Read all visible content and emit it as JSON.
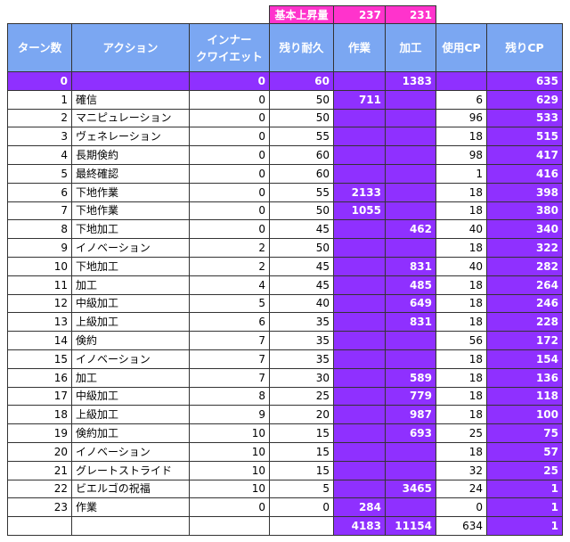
{
  "top": {
    "label": "基本上昇量",
    "craft": "237",
    "quality": "231"
  },
  "headers": [
    "ターン数",
    "アクション",
    "インナー\nクワイエット",
    "残り耐久",
    "作業",
    "加工",
    "使用CP",
    "残りCP"
  ],
  "rows": [
    {
      "turn": "0",
      "action": "",
      "iq": "0",
      "dur": "60",
      "prog": "",
      "qual": "1383",
      "cp_used": "",
      "cp_left": "635"
    },
    {
      "turn": "1",
      "action": "確信",
      "iq": "0",
      "dur": "50",
      "prog": "711",
      "qual": "",
      "cp_used": "6",
      "cp_left": "629"
    },
    {
      "turn": "2",
      "action": "マニピュレーション",
      "iq": "0",
      "dur": "50",
      "prog": "",
      "qual": "",
      "cp_used": "96",
      "cp_left": "533"
    },
    {
      "turn": "3",
      "action": "ヴェネレーション",
      "iq": "0",
      "dur": "55",
      "prog": "",
      "qual": "",
      "cp_used": "18",
      "cp_left": "515"
    },
    {
      "turn": "4",
      "action": "長期倹約",
      "iq": "0",
      "dur": "60",
      "prog": "",
      "qual": "",
      "cp_used": "98",
      "cp_left": "417"
    },
    {
      "turn": "5",
      "action": "最終確認",
      "iq": "0",
      "dur": "60",
      "prog": "",
      "qual": "",
      "cp_used": "1",
      "cp_left": "416"
    },
    {
      "turn": "6",
      "action": "下地作業",
      "iq": "0",
      "dur": "55",
      "prog": "2133",
      "qual": "",
      "cp_used": "18",
      "cp_left": "398"
    },
    {
      "turn": "7",
      "action": "下地作業",
      "iq": "0",
      "dur": "50",
      "prog": "1055",
      "qual": "",
      "cp_used": "18",
      "cp_left": "380"
    },
    {
      "turn": "8",
      "action": "下地加工",
      "iq": "0",
      "dur": "45",
      "prog": "",
      "qual": "462",
      "cp_used": "40",
      "cp_left": "340"
    },
    {
      "turn": "9",
      "action": "イノベーション",
      "iq": "2",
      "dur": "50",
      "prog": "",
      "qual": "",
      "cp_used": "18",
      "cp_left": "322"
    },
    {
      "turn": "10",
      "action": "下地加工",
      "iq": "2",
      "dur": "45",
      "prog": "",
      "qual": "831",
      "cp_used": "40",
      "cp_left": "282"
    },
    {
      "turn": "11",
      "action": "加工",
      "iq": "4",
      "dur": "45",
      "prog": "",
      "qual": "485",
      "cp_used": "18",
      "cp_left": "264"
    },
    {
      "turn": "12",
      "action": "中級加工",
      "iq": "5",
      "dur": "40",
      "prog": "",
      "qual": "649",
      "cp_used": "18",
      "cp_left": "246"
    },
    {
      "turn": "13",
      "action": "上級加工",
      "iq": "6",
      "dur": "35",
      "prog": "",
      "qual": "831",
      "cp_used": "18",
      "cp_left": "228"
    },
    {
      "turn": "14",
      "action": "倹約",
      "iq": "7",
      "dur": "35",
      "prog": "",
      "qual": "",
      "cp_used": "56",
      "cp_left": "172"
    },
    {
      "turn": "15",
      "action": "イノベーション",
      "iq": "7",
      "dur": "35",
      "prog": "",
      "qual": "",
      "cp_used": "18",
      "cp_left": "154"
    },
    {
      "turn": "16",
      "action": "加工",
      "iq": "7",
      "dur": "30",
      "prog": "",
      "qual": "589",
      "cp_used": "18",
      "cp_left": "136"
    },
    {
      "turn": "17",
      "action": "中級加工",
      "iq": "8",
      "dur": "25",
      "prog": "",
      "qual": "779",
      "cp_used": "18",
      "cp_left": "118"
    },
    {
      "turn": "18",
      "action": "上級加工",
      "iq": "9",
      "dur": "20",
      "prog": "",
      "qual": "987",
      "cp_used": "18",
      "cp_left": "100"
    },
    {
      "turn": "19",
      "action": "倹約加工",
      "iq": "10",
      "dur": "15",
      "prog": "",
      "qual": "693",
      "cp_used": "25",
      "cp_left": "75"
    },
    {
      "turn": "20",
      "action": "イノベーション",
      "iq": "10",
      "dur": "15",
      "prog": "",
      "qual": "",
      "cp_used": "18",
      "cp_left": "57"
    },
    {
      "turn": "21",
      "action": "グレートストライド",
      "iq": "10",
      "dur": "15",
      "prog": "",
      "qual": "",
      "cp_used": "32",
      "cp_left": "25"
    },
    {
      "turn": "22",
      "action": "ビエルゴの祝福",
      "iq": "10",
      "dur": "5",
      "prog": "",
      "qual": "3465",
      "cp_used": "24",
      "cp_left": "1"
    },
    {
      "turn": "23",
      "action": "作業",
      "iq": "0",
      "dur": "0",
      "prog": "284",
      "qual": "",
      "cp_used": "0",
      "cp_left": "1"
    }
  ],
  "totals": {
    "prog": "4183",
    "qual": "11154",
    "cp_used": "634",
    "cp_left": "1"
  },
  "colors": {
    "header": "#7ba7f2",
    "pink": "#ff33cc",
    "purple": "#8f30ff"
  }
}
